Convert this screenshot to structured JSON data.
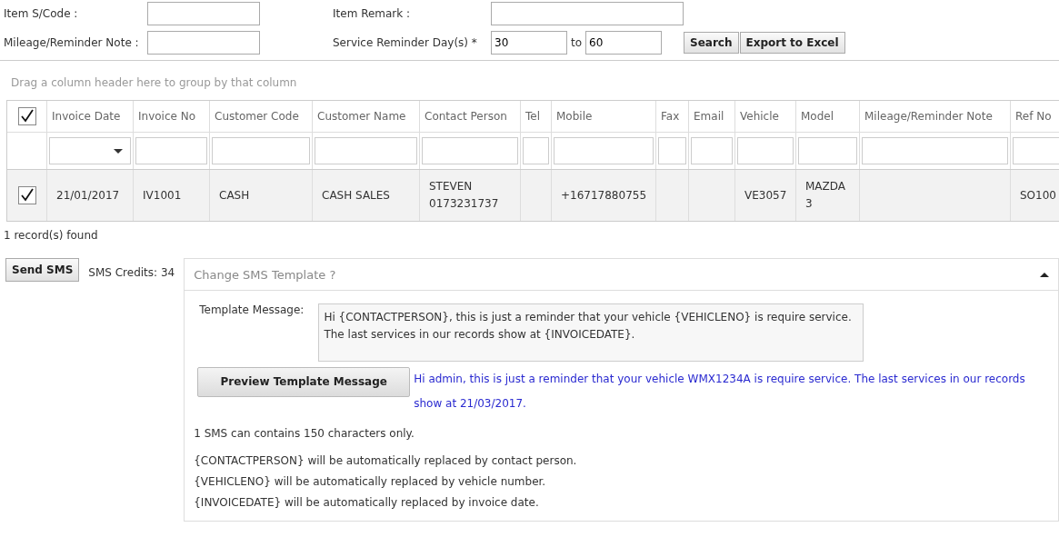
{
  "filters": {
    "item_code": {
      "label": "Item S/Code :"
    },
    "item_remark": {
      "label": "Item Remark :"
    },
    "mileage_note": {
      "label": "Mileage/Reminder Note :"
    },
    "reminder_days": {
      "label": "Service Reminder Day(s) *",
      "from": "30",
      "separator": "to",
      "to": "60"
    },
    "buttons": [
      "Search",
      "Export to Excel"
    ]
  },
  "group_hint": "Drag a column header here to group by that column",
  "table": {
    "select_all_checked": true,
    "columns": [
      "Invoice Date",
      "Invoice No",
      "Customer Code",
      "Customer Name",
      "Contact Person",
      "Tel",
      "Mobile",
      "Fax",
      "Email",
      "Vehicle",
      "Model",
      "Mileage/Reminder Note",
      "Ref No"
    ],
    "filter_row": [
      {
        "kind": "dropdown"
      },
      {
        "kind": "text"
      },
      {
        "kind": "text"
      },
      {
        "kind": "text"
      },
      {
        "kind": "text"
      },
      {
        "kind": "text"
      },
      {
        "kind": "text"
      },
      {
        "kind": "text"
      },
      {
        "kind": "text"
      },
      {
        "kind": "text"
      },
      {
        "kind": "text"
      },
      {
        "kind": "text"
      },
      {
        "kind": "text"
      }
    ],
    "rows": [
      {
        "checked": true,
        "cells": [
          "21/01/2017",
          "IV1001",
          "CASH",
          "CASH SALES",
          "STEVEN 0173231737",
          "",
          "+16717880755",
          "",
          "",
          "VE3057",
          "MAZDA 3",
          "",
          "SO100"
        ]
      }
    ]
  },
  "record_count": "1 record(s) found",
  "sms": {
    "send_button": "Send SMS",
    "credits": "SMS Credits: 34",
    "template_panel": {
      "title": "Change SMS Template ?",
      "expanded": true,
      "message_label": "Template Message:",
      "message": "Hi {CONTACTPERSON}, this is just a reminder that your vehicle {VEHICLENO} is require service.\nThe last services in our records show at {INVOICEDATE}.",
      "preview_button": "Preview Template Message",
      "preview_text": "Hi admin, this is just a reminder that your vehicle WMX1234A is require service. The last services in our records show at 21/03/2017.",
      "notes": [
        "1 SMS can contains 150 characters only."
      ],
      "replacements": [
        "{CONTACTPERSON} will be automatically replaced by contact person.",
        "{VEHICLENO} will be automatically replaced by vehicle number.",
        "{INVOICEDATE} will be automatically replaced by invoice date."
      ]
    }
  }
}
